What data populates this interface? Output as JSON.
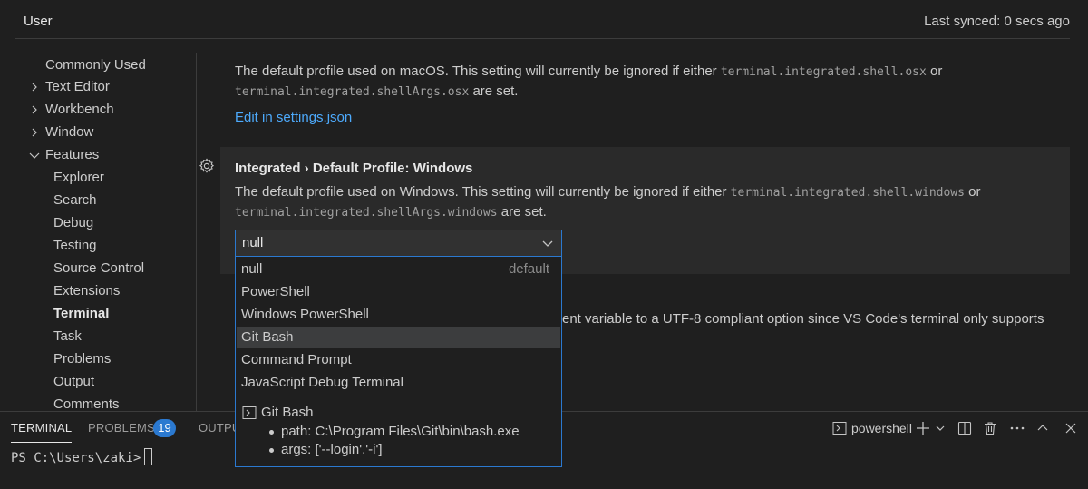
{
  "header": {
    "tab_label": "User",
    "last_synced": "Last synced: 0 secs ago"
  },
  "toc": {
    "items": [
      {
        "label": "Commonly Used"
      },
      {
        "label": "Text Editor",
        "chevron": "chevron-right-icon"
      },
      {
        "label": "Workbench",
        "chevron": "chevron-right-icon"
      },
      {
        "label": "Window",
        "chevron": "chevron-right-icon"
      },
      {
        "label": "Features",
        "chevron": "chevron-down-icon"
      },
      {
        "label": "Explorer"
      },
      {
        "label": "Search"
      },
      {
        "label": "Debug"
      },
      {
        "label": "Testing"
      },
      {
        "label": "Source Control"
      },
      {
        "label": "Extensions"
      },
      {
        "label": "Terminal",
        "selected": true
      },
      {
        "label": "Task"
      },
      {
        "label": "Problems"
      },
      {
        "label": "Output"
      },
      {
        "label": "Comments"
      }
    ]
  },
  "osx_setting": {
    "desc_pre": "The default profile used on macOS. This setting will currently be ignored if either ",
    "code1": "terminal.integrated.shell.osx",
    "desc_mid": " or",
    "code2": "terminal.integrated.shellArgs.osx",
    "desc_post": " are set.",
    "edit_link": "Edit in settings.json"
  },
  "windows_setting": {
    "title_category": "Integrated › ",
    "title_name": "Default Profile: Windows",
    "desc_pre": "The default profile used on Windows. This setting will currently be ignored if either ",
    "code1": "terminal.integrated.shell.windows",
    "desc_mid": " or",
    "code2": "terminal.integrated.shellArgs.windows",
    "desc_post": " are set.",
    "selected_value": "null"
  },
  "behind_text": "ent variable to a UTF-8 compliant option since VS Code's terminal only supports",
  "dropdown": {
    "options": [
      {
        "label": "null",
        "hint": "default"
      },
      {
        "label": "PowerShell"
      },
      {
        "label": "Windows PowerShell"
      },
      {
        "label": "Git Bash",
        "highlighted": true
      },
      {
        "label": "Command Prompt"
      },
      {
        "label": "JavaScript Debug Terminal"
      }
    ],
    "description": {
      "title": "Git Bash",
      "path": "path: C:\\Program Files\\Git\\bin\\bash.exe",
      "args": "args: ['--login','-i']"
    }
  },
  "panel": {
    "tabs": [
      "TERMINAL",
      "PROBLEMS",
      "OUTPU"
    ],
    "problems_count": "19",
    "terminal_name": "powershell",
    "prompt": "PS C:\\Users\\zaki>"
  },
  "colors": {
    "accent": "#2b79d0",
    "link": "#4daafc",
    "background": "#1f1f1f"
  }
}
